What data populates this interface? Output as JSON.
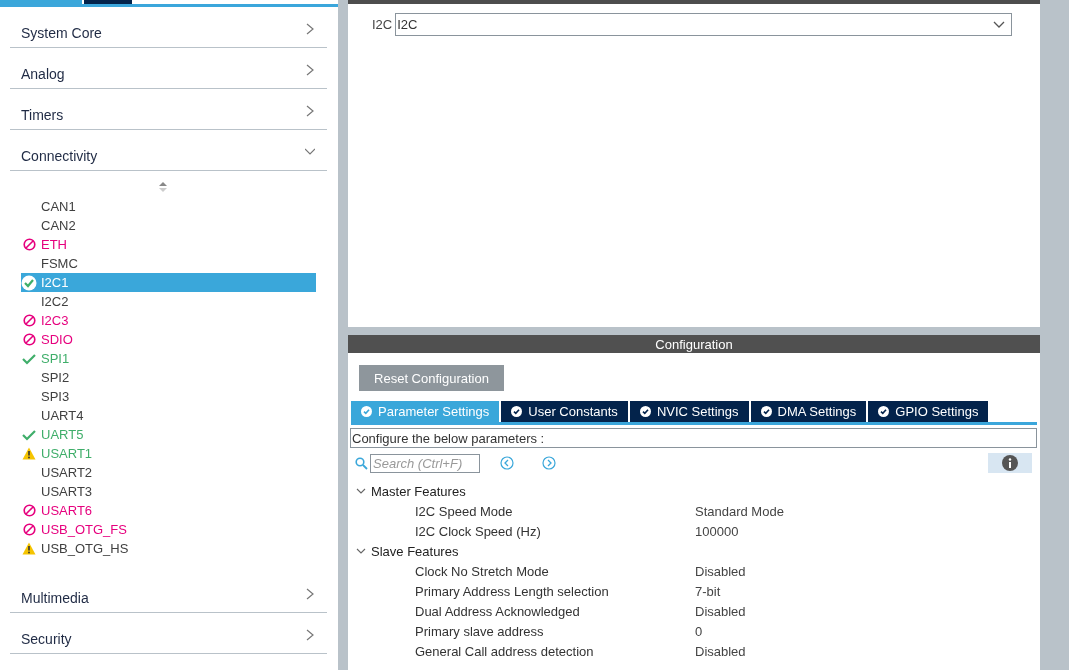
{
  "sidebar": {
    "categories_top": [
      {
        "label": "System Core",
        "expanded": false
      },
      {
        "label": "Analog",
        "expanded": false
      },
      {
        "label": "Timers",
        "expanded": false
      },
      {
        "label": "Connectivity",
        "expanded": true
      }
    ],
    "items": [
      {
        "label": "CAN1",
        "kind": "none",
        "color": "#404040",
        "selected": false
      },
      {
        "label": "CAN2",
        "kind": "none",
        "color": "#404040",
        "selected": false
      },
      {
        "label": "ETH",
        "kind": "blocked",
        "color": "#e6007e",
        "selected": false
      },
      {
        "label": "FSMC",
        "kind": "none",
        "color": "#404040",
        "selected": false
      },
      {
        "label": "I2C1",
        "kind": "configured",
        "selected": true
      },
      {
        "label": "I2C2",
        "kind": "none",
        "color": "#404040",
        "selected": false
      },
      {
        "label": "I2C3",
        "kind": "blocked",
        "color": "#e6007e",
        "selected": false
      },
      {
        "label": "SDIO",
        "kind": "blocked",
        "color": "#e6007e",
        "selected": false
      },
      {
        "label": "SPI1",
        "kind": "configured",
        "color": "#3fae6a",
        "selected": false
      },
      {
        "label": "SPI2",
        "kind": "none",
        "color": "#404040",
        "selected": false
      },
      {
        "label": "SPI3",
        "kind": "none",
        "color": "#404040",
        "selected": false
      },
      {
        "label": "UART4",
        "kind": "none",
        "color": "#404040",
        "selected": false
      },
      {
        "label": "UART5",
        "kind": "configured",
        "color": "#3fae6a",
        "selected": false
      },
      {
        "label": "USART1",
        "kind": "warning",
        "color": "#3fae6a",
        "selected": false
      },
      {
        "label": "USART2",
        "kind": "none",
        "color": "#404040",
        "selected": false
      },
      {
        "label": "USART3",
        "kind": "none",
        "color": "#404040",
        "selected": false
      },
      {
        "label": "USART6",
        "kind": "blocked",
        "color": "#e6007e",
        "selected": false
      },
      {
        "label": "USB_OTG_FS",
        "kind": "blocked",
        "color": "#e6007e",
        "selected": false
      },
      {
        "label": "USB_OTG_HS",
        "kind": "warning",
        "color": "#404040",
        "selected": false
      }
    ],
    "categories_bottom": [
      {
        "label": "Multimedia",
        "expanded": false
      },
      {
        "label": "Security",
        "expanded": false
      }
    ]
  },
  "mode": {
    "label": "I2C",
    "value": "I2C"
  },
  "configuration": {
    "title": "Configuration",
    "reset_button": "Reset Configuration",
    "tabs": [
      {
        "label": "Parameter Settings",
        "selected": true
      },
      {
        "label": "User Constants",
        "selected": false
      },
      {
        "label": "NVIC Settings",
        "selected": false
      },
      {
        "label": "DMA Settings",
        "selected": false
      },
      {
        "label": "GPIO Settings",
        "selected": false
      }
    ],
    "hint": "Configure the below parameters :",
    "search_placeholder": "Search (Ctrl+F)",
    "groups": [
      {
        "label": "Master Features",
        "expanded": true,
        "params": [
          {
            "name": "I2C Speed Mode",
            "value": "Standard Mode"
          },
          {
            "name": "I2C Clock Speed (Hz)",
            "value": "100000"
          }
        ]
      },
      {
        "label": "Slave Features",
        "expanded": true,
        "params": [
          {
            "name": "Clock No Stretch Mode",
            "value": "Disabled"
          },
          {
            "name": "Primary Address Length selection",
            "value": "7-bit"
          },
          {
            "name": "Dual Address Acknowledged",
            "value": "Disabled"
          },
          {
            "name": "Primary slave address",
            "value": "0"
          },
          {
            "name": "General Call address detection",
            "value": "Disabled"
          }
        ]
      }
    ]
  }
}
